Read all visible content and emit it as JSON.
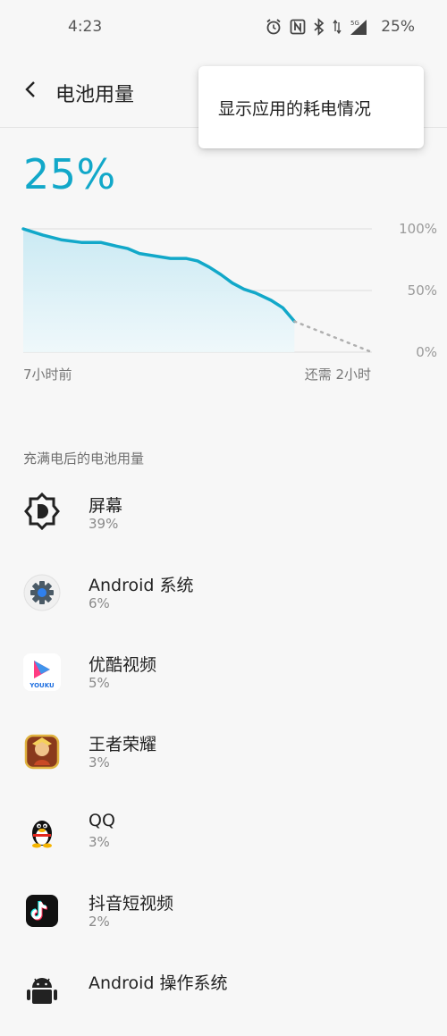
{
  "status_bar": {
    "time": "4:23",
    "icons": [
      "alarm-icon",
      "nfc-icon",
      "bluetooth-icon",
      "data-arrows-icon",
      "signal-5g-icon"
    ],
    "battery_text": "25%"
  },
  "header": {
    "title": "电池用量"
  },
  "popup_menu": {
    "items": [
      "显示应用的耗电情况"
    ]
  },
  "battery": {
    "level_text": "25%"
  },
  "chart_data": {
    "type": "area",
    "y_tick_labels": [
      "100%",
      "50%",
      "0%"
    ],
    "ylim": [
      0,
      100
    ],
    "x_labels": {
      "start": "7小时前",
      "end": "还需 2小时"
    },
    "history_series": {
      "x_hours": [
        -7,
        -6.8,
        -6.5,
        -6,
        -5.5,
        -5,
        -4.6,
        -4.3,
        -4,
        -3.6,
        -3.2,
        -2.8,
        -2.5,
        -2.2,
        -1.9,
        -1.6,
        -1.3,
        -1,
        -0.6,
        -0.3,
        0
      ],
      "values": [
        100,
        98,
        95,
        91,
        89,
        89,
        86,
        84,
        80,
        78,
        76,
        76,
        74,
        69,
        63,
        56,
        51,
        48,
        42,
        36,
        25
      ]
    },
    "prediction": {
      "from_value": 25,
      "to_value": 0,
      "hours": 2
    },
    "grid": true,
    "colors": {
      "line": "#12a8c9",
      "fill": "#d4eef6",
      "grid": "#dcdcdc",
      "prediction": "#b0b0b0"
    }
  },
  "usage": {
    "section_title": "充满电后的电池用量",
    "items": [
      {
        "name": "屏幕",
        "percent": "39%",
        "icon": "screen-brightness-icon"
      },
      {
        "name": "Android 系统",
        "percent": "6%",
        "icon": "android-system-gear-icon"
      },
      {
        "name": "优酷视频",
        "percent": "5%",
        "icon": "youku-icon"
      },
      {
        "name": "王者荣耀",
        "percent": "3%",
        "icon": "honor-of-kings-icon"
      },
      {
        "name": "QQ",
        "percent": "3%",
        "icon": "qq-penguin-icon"
      },
      {
        "name": "抖音短视频",
        "percent": "2%",
        "icon": "douyin-icon"
      },
      {
        "name": "Android 操作系统",
        "percent": "",
        "icon": "android-robot-icon"
      }
    ],
    "youku_logo_text": "YOUKU"
  }
}
